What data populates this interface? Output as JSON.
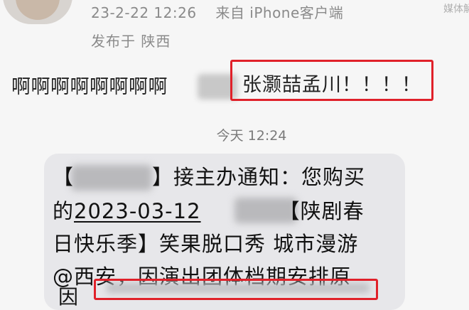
{
  "header": {
    "timestamp": "23-2-22 12:26",
    "source": "来自 iPhone客户端",
    "location": "发布于 陕西",
    "watermark": "媒体解"
  },
  "post": {
    "text_prefix": "啊啊啊啊啊啊啊啊",
    "highlighted_text": "张灏喆孟川！！！！"
  },
  "divider": {
    "time_label": "今天",
    "time_value": "12:24"
  },
  "sms": {
    "line1_bracket_open": "【",
    "line1_text": "】接主办通知：您购买",
    "line2_prefix": "的",
    "line2_date": "2023-03-12",
    "line2_suffix": "【陕剧春",
    "line3_text": "日快乐季】笑果脱口秀 城市漫游",
    "line4_text": "@西安，因演出团体档期安排原",
    "line5_peek": "因"
  }
}
